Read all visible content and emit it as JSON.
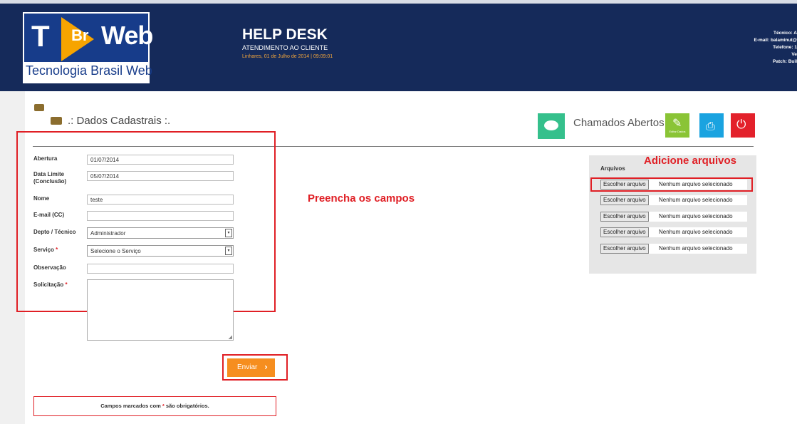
{
  "header": {
    "logo": {
      "letters_t": "T",
      "letters_br": "Br",
      "letters_web": "Web",
      "caption": "Tecnologia Brasil Web"
    },
    "title": "HELP DESK",
    "subtitle": "ATENDIMENTO AO CLIENTE",
    "date_line": "Linhares, 01 de Julho de 2014   |   09:09:01",
    "info": [
      "Técnico: A",
      "E-mail: balaminut@",
      "Telefone: 1",
      "Ve",
      "Patch: Buil"
    ]
  },
  "section": {
    "title": ".: Dados Cadastrais :."
  },
  "toolbar": {
    "chamados_label": "Chamados Abertos",
    "edit_caption": "Editar Dados",
    "icons": {
      "chat": "chat-icon",
      "edit": "pencil-icon",
      "print": "printer-icon",
      "power": "power-icon"
    },
    "colors": {
      "chat": "#35c08c",
      "edit": "#8ac436",
      "print": "#1aa3e0",
      "power": "#e3212b"
    }
  },
  "form": {
    "abertura": {
      "label": "Abertura",
      "value": "01/07/2014"
    },
    "data_limite": {
      "label_line1": "Data Limite",
      "label_line2": "(Conclusão)",
      "value": "05/07/2014"
    },
    "nome": {
      "label": "Nome",
      "value": "teste"
    },
    "email": {
      "label": "E-mail (CC)",
      "value": ""
    },
    "depto": {
      "label": "Depto / Técnico",
      "value": "Administrador"
    },
    "servico": {
      "label": "Serviço",
      "required_mark": "*",
      "value": "Selecione o Serviço"
    },
    "observacao": {
      "label": "Observação",
      "value": ""
    },
    "solicitacao": {
      "label": "Solicitação",
      "required_mark": "*",
      "value": ""
    }
  },
  "annotations": {
    "fill_fields": "Preencha os campos",
    "add_files": "Adicione arquivos",
    "color": "#e01f25"
  },
  "files": {
    "title": "Arquivos",
    "rows": [
      {
        "button": "Escolher arquivo",
        "status": "Nenhum arquivo selecionado"
      },
      {
        "button": "Escolher arquivo",
        "status": "Nenhum arquivo selecionado"
      },
      {
        "button": "Escolher arquivo",
        "status": "Nenhum arquivo selecionado"
      },
      {
        "button": "Escolher arquivo",
        "status": "Nenhum arquivo selecionado"
      },
      {
        "button": "Escolher arquivo",
        "status": "Nenhum arquivo selecionado"
      }
    ]
  },
  "submit": {
    "label": "Enviar",
    "chevron": "›",
    "color": "#f68e1f"
  },
  "notice": {
    "before": "Campos marcados com ",
    "mark": "*",
    "after": " são obrigatórios."
  }
}
